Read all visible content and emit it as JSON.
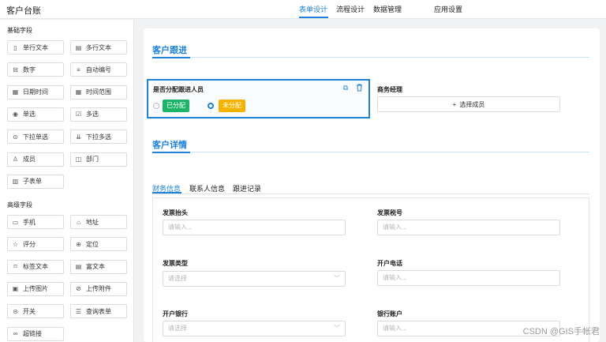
{
  "app": {
    "title": "客户台账"
  },
  "nav": {
    "tabs": [
      "表单设计",
      "流程设计",
      "数据管理",
      "应用设置"
    ]
  },
  "sidebar": {
    "basic_title": "基础字段",
    "basic_items": [
      {
        "label": "单行文本",
        "icon": "file-icon"
      },
      {
        "label": "多行文本",
        "icon": "file-lines-icon"
      },
      {
        "label": "数字",
        "icon": "number-icon"
      },
      {
        "label": "自动编号",
        "icon": "list-number-icon"
      },
      {
        "label": "日期时间",
        "icon": "calendar-icon"
      },
      {
        "label": "时间范围",
        "icon": "calendar-range-icon"
      },
      {
        "label": "单选",
        "icon": "radio-icon"
      },
      {
        "label": "多选",
        "icon": "checkbox-icon"
      },
      {
        "label": "下拉单选",
        "icon": "dropdown-icon"
      },
      {
        "label": "下拉多选",
        "icon": "dropdown-multi-icon"
      },
      {
        "label": "成员",
        "icon": "user-icon"
      },
      {
        "label": "部门",
        "icon": "department-icon"
      },
      {
        "label": "子表单",
        "icon": "subform-icon"
      }
    ],
    "advanced_title": "高级字段",
    "advanced_items": [
      {
        "label": "手机",
        "icon": "phone-icon"
      },
      {
        "label": "地址",
        "icon": "address-icon"
      },
      {
        "label": "评分",
        "icon": "star-icon"
      },
      {
        "label": "定位",
        "icon": "location-icon"
      },
      {
        "label": "标签文本",
        "icon": "tag-icon"
      },
      {
        "label": "富文本",
        "icon": "rich-text-icon"
      },
      {
        "label": "上传图片",
        "icon": "image-icon"
      },
      {
        "label": "上传附件",
        "icon": "attachment-icon"
      },
      {
        "label": "开关",
        "icon": "toggle-icon"
      },
      {
        "label": "查询表单",
        "icon": "query-icon"
      },
      {
        "label": "超链接",
        "icon": "link-icon"
      }
    ]
  },
  "form": {
    "group1_title": "客户跟进",
    "assign_field": {
      "label": "是否分配跟进人员",
      "options": [
        {
          "label": "已分配",
          "color": "#1fb36a",
          "checked": false
        },
        {
          "label": "未分配",
          "color": "#f5b300",
          "checked": true
        }
      ]
    },
    "manager_field": {
      "label": "商务经理",
      "button": "选择成员",
      "button_icon": "+"
    },
    "group2_title": "客户详情",
    "tabs": [
      "财务信息",
      "联系人信息",
      "跟进记录"
    ],
    "fields": [
      {
        "label": "发票抬头",
        "placeholder": "请输入..."
      },
      {
        "label": "发票税号",
        "placeholder": "请输入..."
      },
      {
        "label": "发票类型",
        "placeholder": "请选择"
      },
      {
        "label": "开户电话",
        "placeholder": "请输入..."
      },
      {
        "label": "开户银行",
        "placeholder": "请选择"
      },
      {
        "label": "银行账户",
        "placeholder": "请输入..."
      }
    ]
  },
  "watermark": "CSDN @GIS手帐君",
  "colors": {
    "accent": "#1f82d9",
    "assigned": "#1fb36a",
    "unassigned": "#f5b300"
  }
}
